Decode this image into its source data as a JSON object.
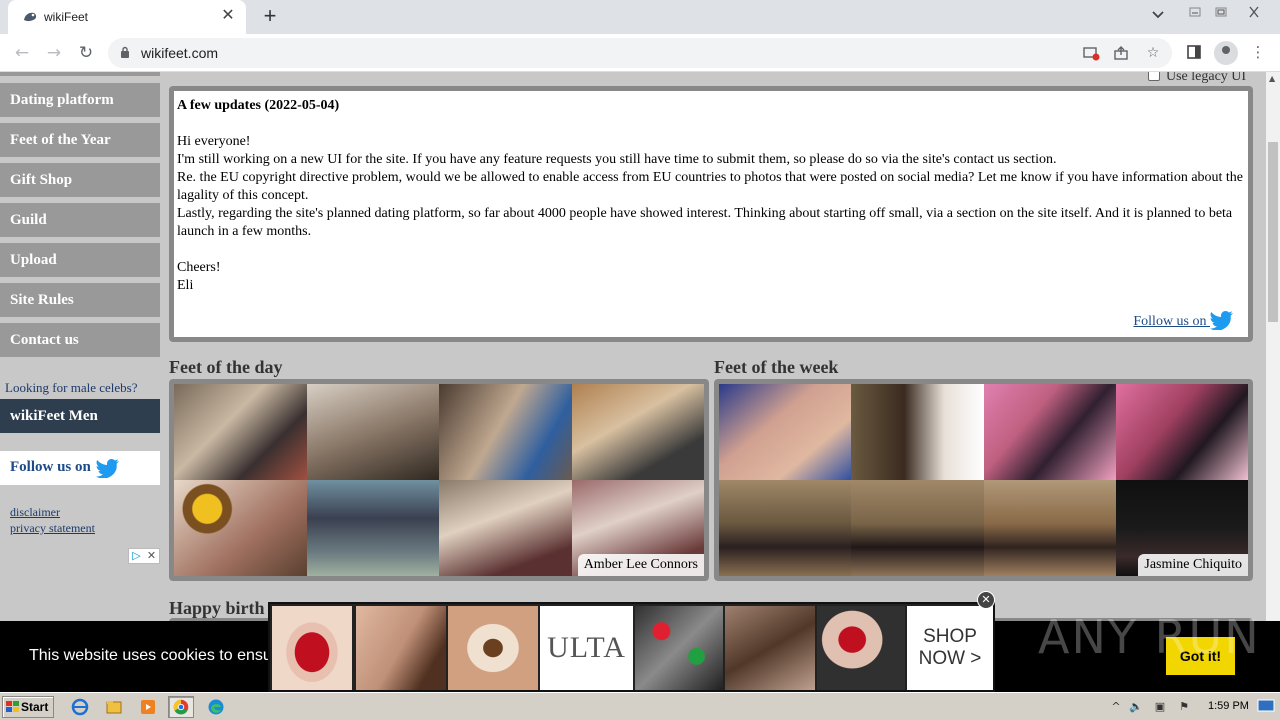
{
  "browser": {
    "tab_title": "wikiFeet",
    "url": "wikifeet.com",
    "new_tab_symbol": "+",
    "tab_close_symbol": "✕"
  },
  "page": {
    "legacy_label": "Use legacy UI",
    "sidebar": {
      "items": [
        {
          "label": "Dating platform"
        },
        {
          "label": "Feet of the Year"
        },
        {
          "label": "Gift Shop"
        },
        {
          "label": "Guild"
        },
        {
          "label": "Upload"
        },
        {
          "label": "Site Rules"
        },
        {
          "label": "Contact us"
        }
      ],
      "male_prompt": "Looking for male celebs?",
      "men_button": "wikiFeet Men",
      "follow_label": "Follow us on",
      "disclaimer": "disclaimer",
      "privacy": "privacy statement"
    },
    "news": {
      "title": "A few updates (2022-05-04)",
      "greeting": "Hi everyone!",
      "p1": "I'm still working on a new UI for the site. If you have any feature requests you still have time to submit them, so please do so via the site's contact us section.",
      "p2": "Re. the EU copyright directive problem, would we be allowed to enable access from EU countries to photos that were posted on social media? Let me know if you have information about the lagality of this concept.",
      "p3": "Lastly, regarding the site's planned dating platform, so far about 4000 people have showed interest. Thinking about starting off small, via a section on the site itself. And it is planned to beta launch in a few months.",
      "closing": "Cheers!",
      "signature": "Eli",
      "follow_label": "Follow us on"
    },
    "feet_of_day": {
      "title": "Feet of the day",
      "caption": "Amber Lee Connors"
    },
    "feet_of_week": {
      "title": "Feet of the week",
      "caption": "Jasmine Chiquito"
    },
    "birthday_title": "Happy birth"
  },
  "cookie": {
    "text": "This website uses cookies to ensu",
    "button": "Got it!"
  },
  "ad": {
    "brand": "ULTA",
    "cta_line1": "SHOP",
    "cta_line2": "NOW >",
    "close": "✕",
    "choices": "▷✕"
  },
  "watermark": "ANY RUN",
  "taskbar": {
    "start": "Start",
    "time": "1:59 PM"
  },
  "colors": {
    "menu_bg": "#999999",
    "men_button_bg": "#2e3e4e",
    "link": "#1c3a6b",
    "twitter": "#1d9bf0",
    "cookie_button": "#f1d600"
  }
}
